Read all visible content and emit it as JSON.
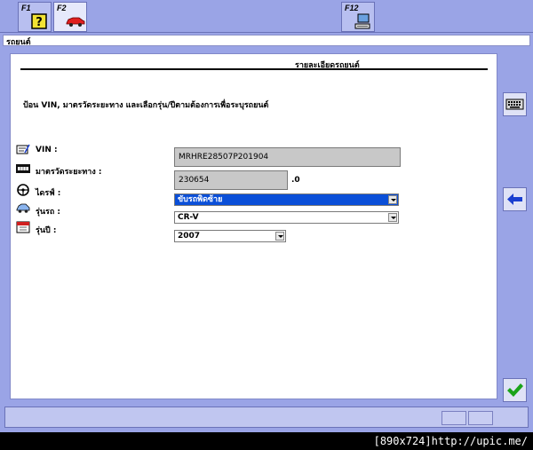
{
  "toolbar": {
    "keys": [
      {
        "label": "F1",
        "icon": "help-question-icon"
      },
      {
        "label": "F2",
        "icon": "car-icon"
      },
      {
        "label": "F12",
        "icon": "computer-icon"
      }
    ]
  },
  "breadcrumb": "รถยนต์",
  "main": {
    "title": "รายละเอียดรถยนต์",
    "instruction": "ป้อน VIN, มาตรวัดระยะทาง และเลือกรุ่น/ปีตามต้องการเพื่อระบุรถยนต์",
    "vin": {
      "label": "VIN :",
      "value": "MRHRE28507P201904"
    },
    "odometer": {
      "label": "มาตรวัดระยะทาง :",
      "value": "230654",
      "suffix": ".0"
    },
    "drive": {
      "label": "ไดรฟ์ :",
      "value": "ขับรถพิดซ้าย"
    },
    "model": {
      "label": "รุ่นรถ :",
      "value": "CR-V"
    },
    "year": {
      "label": "รุ่นปี :",
      "value": "2007"
    }
  },
  "sidebar": {
    "buttons": [
      {
        "icon": "keyboard-icon"
      },
      {
        "icon": "back-arrow-icon"
      },
      {
        "icon": "checkmark-icon"
      }
    ]
  },
  "colors": {
    "background": "#9aa4e6",
    "selected": "#0a4fd8",
    "check": "#1aa31a",
    "arrow": "#1a3fd0"
  },
  "footer": {
    "watermark": "[890x724]http://upic.me/"
  }
}
